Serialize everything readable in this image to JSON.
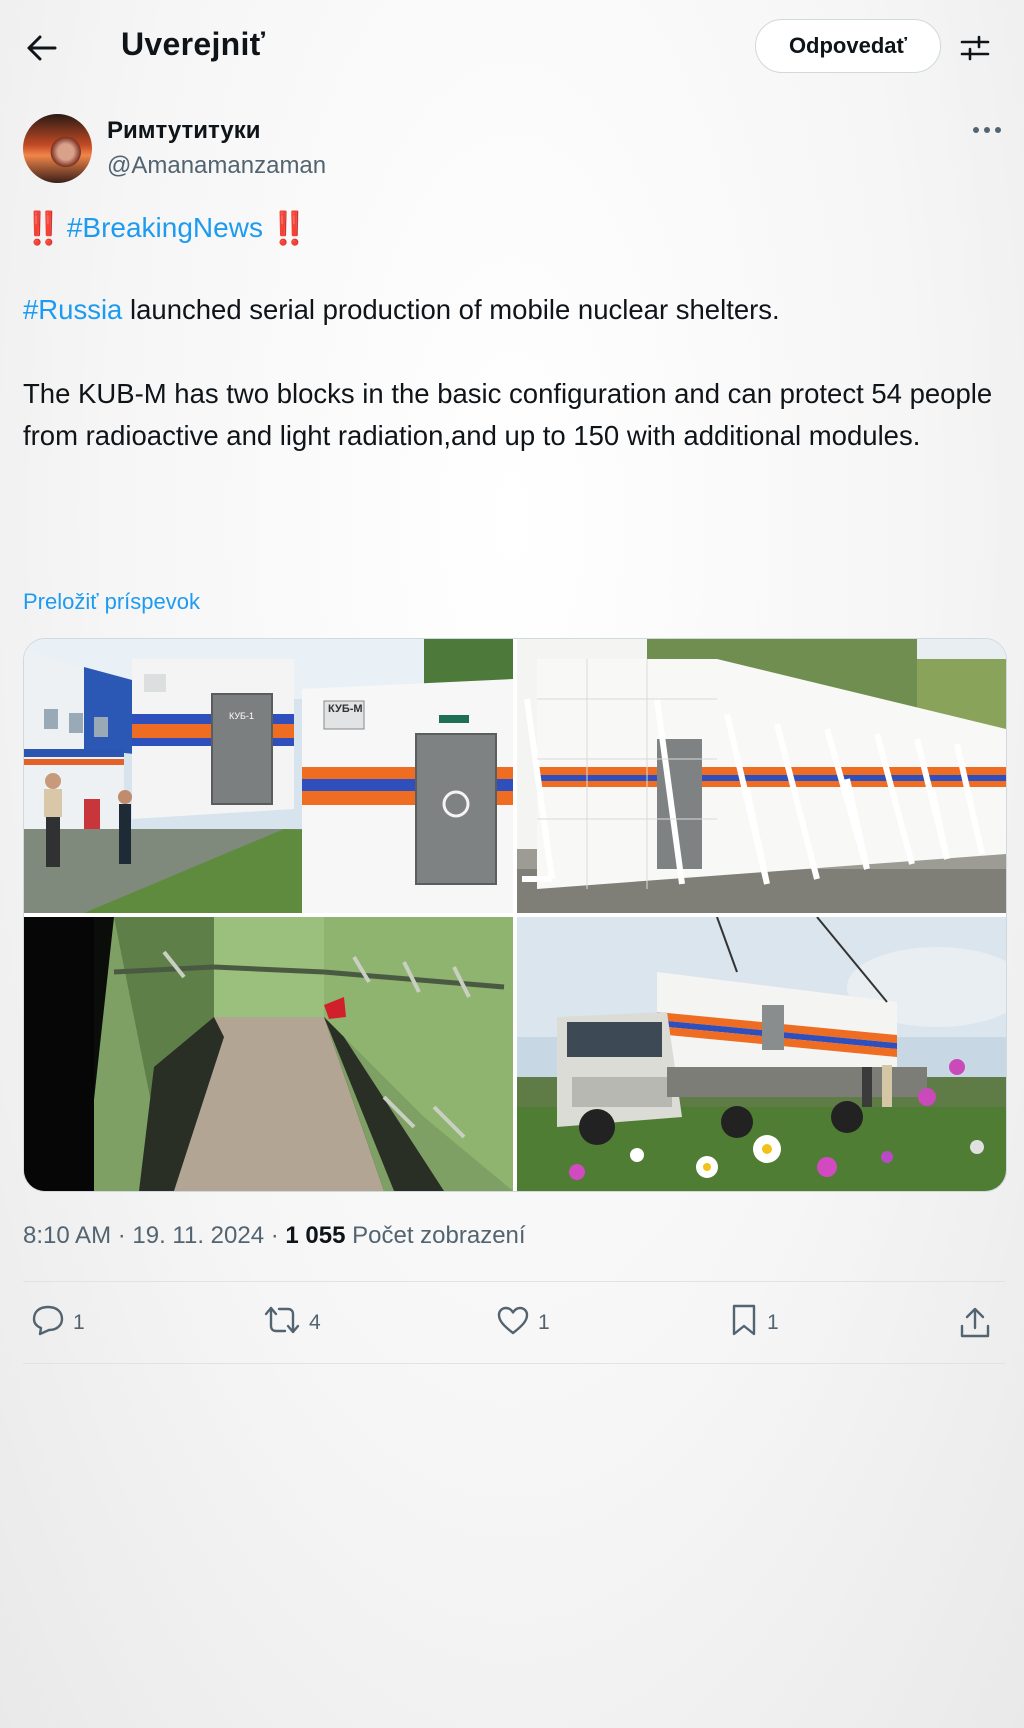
{
  "header": {
    "title": "Uverejniť",
    "reply_label": "Odpovedať"
  },
  "author": {
    "name": "Римтутитуки",
    "handle": "@Amanamanzaman"
  },
  "post": {
    "bang_left": "‼️",
    "hashtag_breaking": "#BreakingNews",
    "bang_right": "‼️",
    "hashtag_russia": "#Russia",
    "line2_rest": " launched serial production of mobile nuclear shelters.",
    "paragraph3": "The KUB-M has two blocks in the basic configuration and can protect 54 people from radioactive and light radiation,and up to 150 with additional modules.",
    "translate_label": "Preložiť príspevok"
  },
  "media": {
    "count": 4,
    "photo1_door_label": "КУБ-1",
    "photo1_sign": "КУБ-М"
  },
  "meta": {
    "time": "8:10 AM",
    "sep1": " · ",
    "date": "19. 11. 2024",
    "sep2": " · ",
    "views": "1 055",
    "views_label": " Počet zobrazení"
  },
  "actions": {
    "replies": "1",
    "reposts": "4",
    "likes": "1",
    "bookmarks": "1"
  },
  "colors": {
    "accent": "#1d9bf0",
    "alert": "#d0121b",
    "text": "#0f1419",
    "muted": "#536471"
  },
  "icons": [
    "back-arrow-icon",
    "filter-icon",
    "more-icon",
    "reply-icon",
    "repost-icon",
    "like-icon",
    "bookmark-icon",
    "share-icon"
  ]
}
